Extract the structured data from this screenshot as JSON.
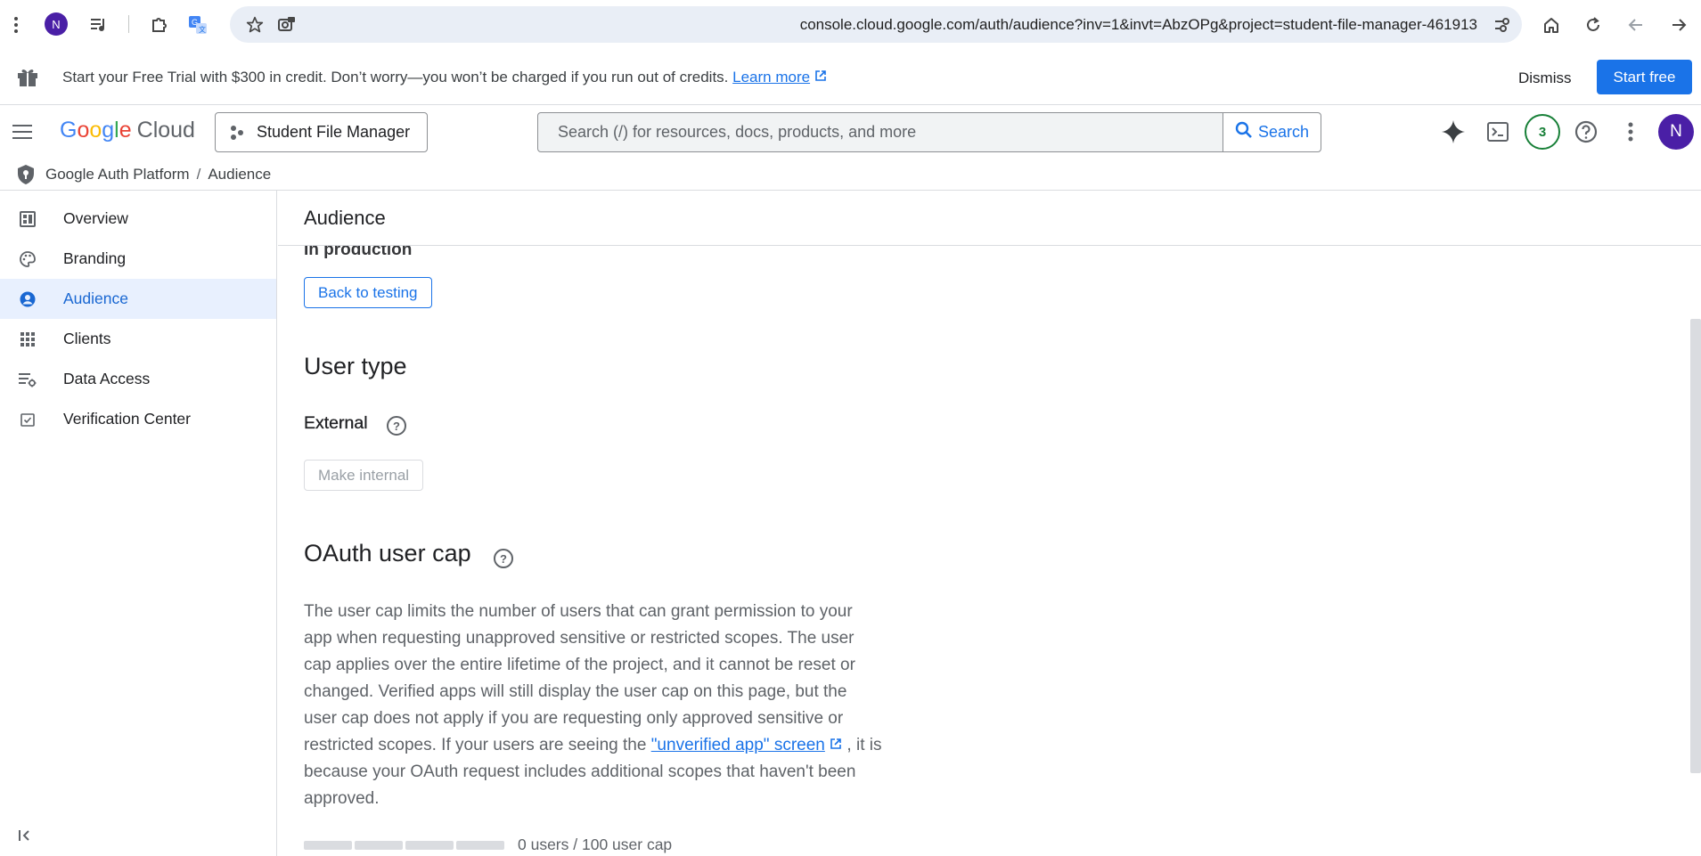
{
  "browser": {
    "avatar_letter": "N",
    "url": "console.cloud.google.com/auth/audience?inv=1&invt=AbzOPg&project=student-file-manager-461913"
  },
  "trial_banner": {
    "message": "Start your Free Trial with $300 in credit. Don’t worry—your won’t be charged if you run out of credits.",
    "message_text": "Start your Free Trial with $300 in credit. Don’t worry—you won’t be charged if you run out of credits.",
    "learn_more": "Learn more",
    "dismiss": "Dismiss",
    "start_free": "Start free"
  },
  "header": {
    "logo_google": "Google",
    "logo_cloud": "Cloud",
    "project": "Student File Manager",
    "search_placeholder": "Search (/) for resources, docs, products, and more",
    "search_button": "Search",
    "notification_count": "3",
    "user_initial": "N"
  },
  "breadcrumb": {
    "parent": "Google Auth Platform",
    "current": "Audience"
  },
  "sidebar": {
    "items": [
      {
        "label": "Overview",
        "icon": "dashboard-icon"
      },
      {
        "label": "Branding",
        "icon": "palette-icon"
      },
      {
        "label": "Audience",
        "icon": "account-circle-icon",
        "active": true
      },
      {
        "label": "Clients",
        "icon": "apps-grid-icon"
      },
      {
        "label": "Data Access",
        "icon": "tune-settings-icon"
      },
      {
        "label": "Verification Center",
        "icon": "check-box-icon"
      }
    ]
  },
  "main": {
    "title": "Audience",
    "publishing_status": "In production",
    "back_to_testing": "Back to testing",
    "user_type_heading": "User type",
    "user_type_value": "External",
    "make_internal": "Make internal",
    "oauth_cap_heading": "OAuth user cap",
    "description_part1": "The user cap limits the number of users that can grant permission to your app when requesting unapproved sensitive or restricted scopes. The user cap applies over the entire lifetime of the project, and it cannot be reset or changed. Verified apps will still display the user cap on this page, but the user cap does not apply if you are requesting only approved sensitive or restricted scopes. If your users are seeing the ",
    "unverified_link": "\"unverified app\" screen",
    "description_part2": " , it is because your OAuth request includes additional scopes that haven't been approved.",
    "cap_usage": "0 users / 100 user cap",
    "cap_users": 0,
    "cap_limit": 100
  },
  "colors": {
    "accent": "#1a73e8",
    "active_nav_bg": "#e8f0fe",
    "avatar": "#4a1fa6",
    "notif": "#188038"
  }
}
